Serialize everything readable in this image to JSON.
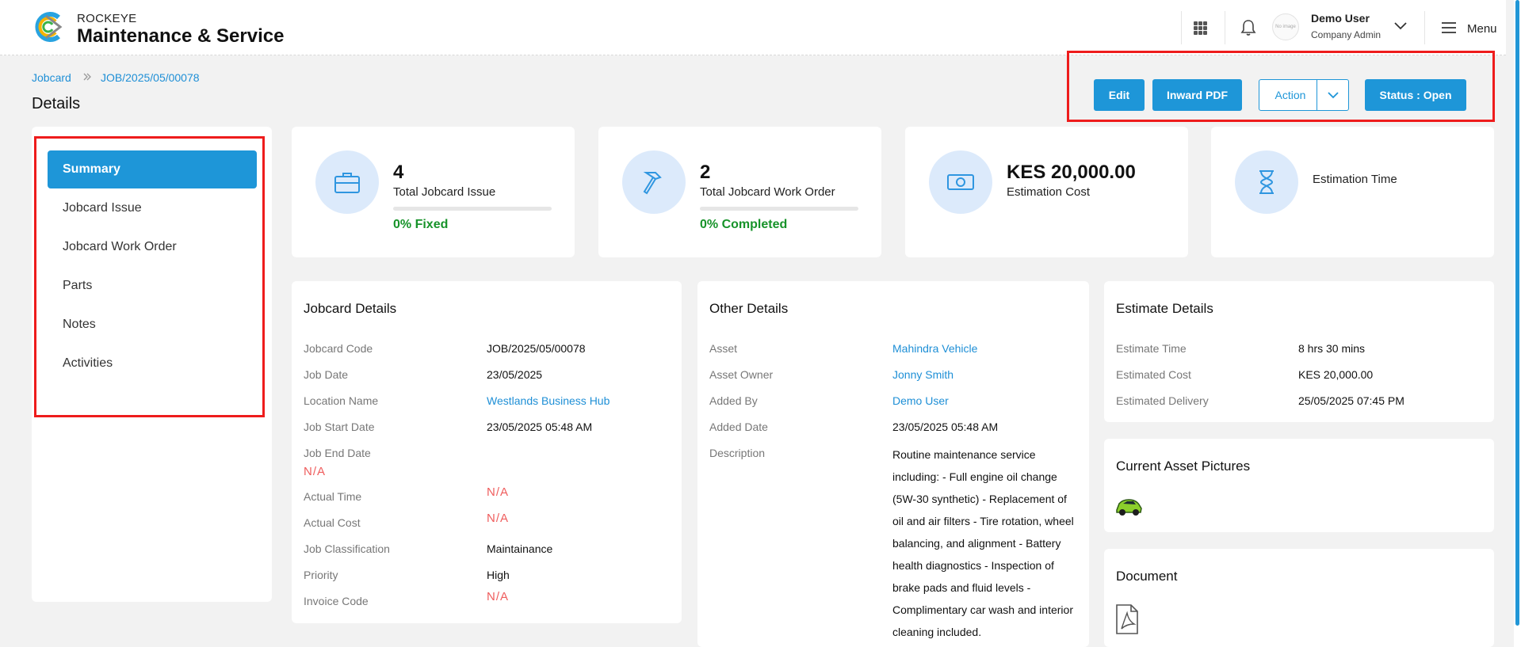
{
  "header": {
    "brand_small": "ROCKEYE",
    "brand_big": "Maintenance & Service",
    "user_name": "Demo User",
    "user_role": "Company Admin",
    "avatar_text": "No image",
    "menu_label": "Menu",
    "icons": [
      "apps-grid-icon",
      "bell-icon",
      "chevron-down-icon",
      "hamburger-icon"
    ]
  },
  "breadcrumb": {
    "root": "Jobcard",
    "current": "JOB/2025/05/00078"
  },
  "page_title": "Details",
  "actions": {
    "edit": "Edit",
    "inward_pdf": "Inward PDF",
    "action": "Action",
    "status": "Status : Open"
  },
  "sidebar": {
    "items": [
      {
        "label": "Summary",
        "active": true
      },
      {
        "label": "Jobcard Issue"
      },
      {
        "label": "Jobcard Work Order"
      },
      {
        "label": "Parts"
      },
      {
        "label": "Notes"
      },
      {
        "label": "Activities"
      }
    ]
  },
  "stats": [
    {
      "value": "4",
      "label": "Total Jobcard Issue",
      "sub": "0% Fixed",
      "progress": 0,
      "icon": "briefcase-icon"
    },
    {
      "value": "2",
      "label": "Total Jobcard Work Order",
      "sub": "0% Completed",
      "progress": 0,
      "icon": "hammer-icon"
    },
    {
      "value": "KES 20,000.00",
      "label": "Estimation Cost",
      "icon": "cash-icon"
    },
    {
      "label": "Estimation Time",
      "icon": "hourglass-icon"
    }
  ],
  "jobcard_details": {
    "title": "Jobcard Details",
    "rows": [
      {
        "label": "Jobcard Code",
        "value": "JOB/2025/05/00078"
      },
      {
        "label": "Job Date",
        "value": "23/05/2025"
      },
      {
        "label": "Location Name",
        "value": "Westlands Business Hub"
      },
      {
        "label": "Job Start Date",
        "value": "23/05/2025 05:48 AM"
      },
      {
        "label": "Job End Date",
        "value": "N/A"
      },
      {
        "label": "Actual Time",
        "value": "N/A"
      },
      {
        "label": "Actual Cost",
        "value": "N/A"
      },
      {
        "label": "Job Classification",
        "value": "Maintainance"
      },
      {
        "label": "Priority",
        "value": "High"
      },
      {
        "label": "Invoice Code",
        "value": "N/A"
      }
    ]
  },
  "other_details": {
    "title": "Other Details",
    "rows": [
      {
        "label": "Asset",
        "value": "Mahindra Vehicle"
      },
      {
        "label": "Asset Owner",
        "value": "Jonny Smith"
      },
      {
        "label": "Added By",
        "value": "Demo User"
      },
      {
        "label": "Added Date",
        "value": "23/05/2025 05:48 AM"
      },
      {
        "label": "Description",
        "value": "Routine maintenance service including: - Full engine oil change (5W-30 synthetic) - Replacement of oil and air filters - Tire rotation, wheel balancing, and alignment - Battery health diagnostics - Inspection of brake pads and fluid levels - Complimentary car wash and interior cleaning included."
      }
    ]
  },
  "estimate_details": {
    "title": "Estimate Details",
    "rows": [
      {
        "label": "Estimate Time",
        "value": "8 hrs 30 mins"
      },
      {
        "label": "Estimated Cost",
        "value": "KES 20,000.00"
      },
      {
        "label": "Estimated Delivery",
        "value": "25/05/2025 07:45 PM"
      }
    ]
  },
  "asset_pictures": {
    "title": "Current Asset Pictures",
    "icon": "car-thumbnail-icon"
  },
  "documents": {
    "title": "Document",
    "icon": "pdf-file-icon"
  },
  "colors": {
    "accent": "#1e96d8",
    "success": "#17932a",
    "na_red": "#ef5d5d",
    "highlight_red": "#ee1c1c"
  }
}
